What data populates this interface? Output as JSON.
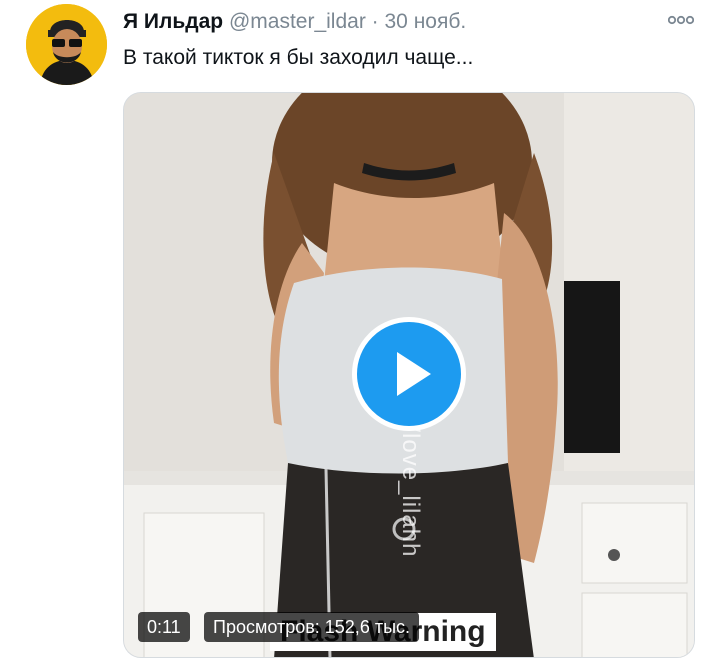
{
  "tweet": {
    "author_name": "Я Ильдар",
    "handle": "@master_ildar",
    "separator": "·",
    "date": "30 нояб.",
    "text": "В такой тикток я бы заходил чаще...",
    "more_icon": "more-options-icon"
  },
  "video": {
    "duration": "0:11",
    "views": "Просмотров: 152,6 тыс.",
    "watermark": "u/love_lilahh",
    "caption_text": "Flash Warning",
    "play_icon": "play-icon",
    "play_color": "#1d9bf0"
  }
}
